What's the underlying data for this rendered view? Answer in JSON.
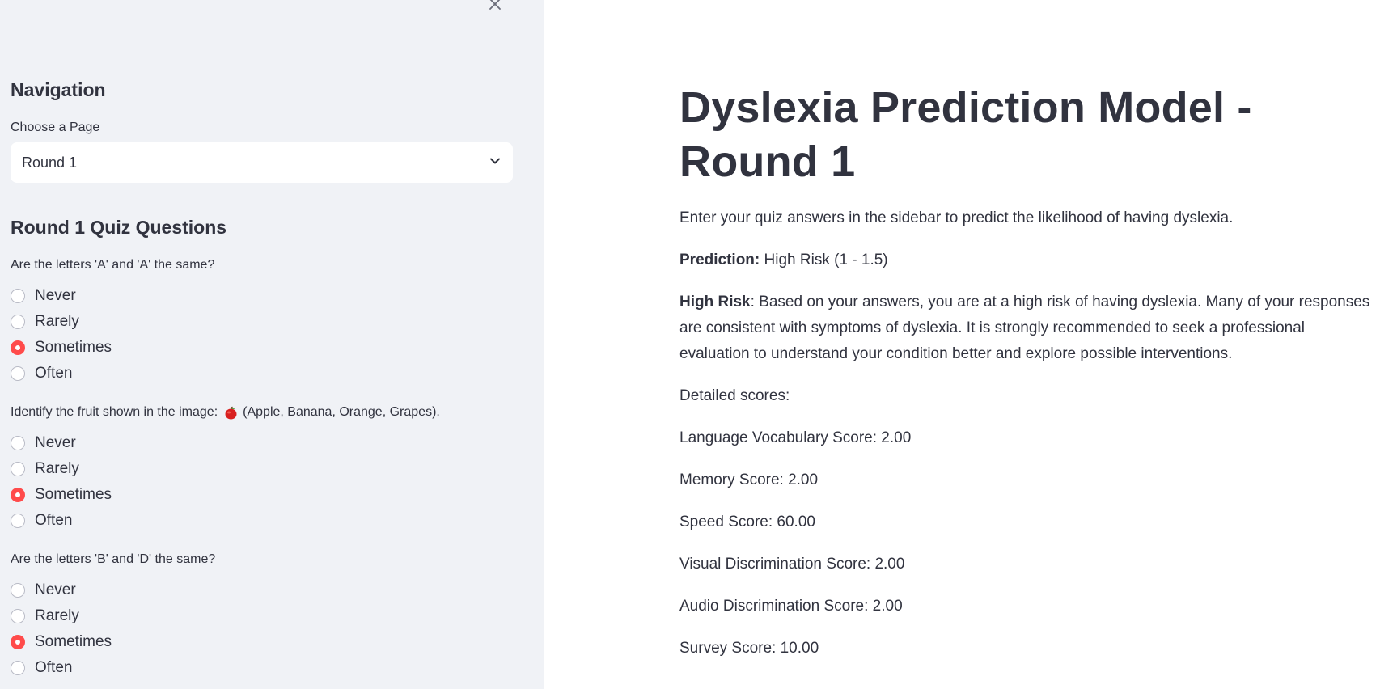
{
  "sidebar": {
    "close_icon": "close-icon",
    "nav_heading": "Navigation",
    "select_label": "Choose a Page",
    "select_value": "Round 1",
    "quiz_heading": "Round 1 Quiz Questions",
    "questions": [
      {
        "label": "Are the letters 'A' and 'A' the same?",
        "options": [
          "Never",
          "Rarely",
          "Sometimes",
          "Often"
        ],
        "selected": "Sometimes"
      },
      {
        "label_before": "Identify the fruit shown in the image:",
        "label_emoji": "apple-icon",
        "label_after": "(Apple, Banana, Orange, Grapes).",
        "options": [
          "Never",
          "Rarely",
          "Sometimes",
          "Often"
        ],
        "selected": "Sometimes"
      },
      {
        "label": "Are the letters 'B' and 'D' the same?",
        "options": [
          "Never",
          "Rarely",
          "Sometimes",
          "Often"
        ],
        "selected": "Sometimes"
      }
    ]
  },
  "main": {
    "title": "Dyslexia Prediction Model - Round 1",
    "intro": "Enter your quiz answers in the sidebar to predict the likelihood of having dyslexia.",
    "prediction_label": "Prediction:",
    "prediction_value": "High Risk (1 - 1.5)",
    "risk_label": "High Risk",
    "risk_text": ": Based on your answers, you are at a high risk of having dyslexia. Many of your responses are consistent with symptoms of dyslexia. It is strongly recommended to seek a professional evaluation to understand your condition better and explore possible interventions.",
    "scores_heading": "Detailed scores:",
    "scores": [
      "Language Vocabulary Score: 2.00",
      "Memory Score: 2.00",
      "Speed Score: 60.00",
      "Visual Discrimination Score: 2.00",
      "Audio Discrimination Score: 2.00",
      "Survey Score: 10.00"
    ]
  },
  "colors": {
    "sidebar_bg": "#f0f2f6",
    "accent_radio": "#ff4b4b",
    "text": "#31333f"
  }
}
